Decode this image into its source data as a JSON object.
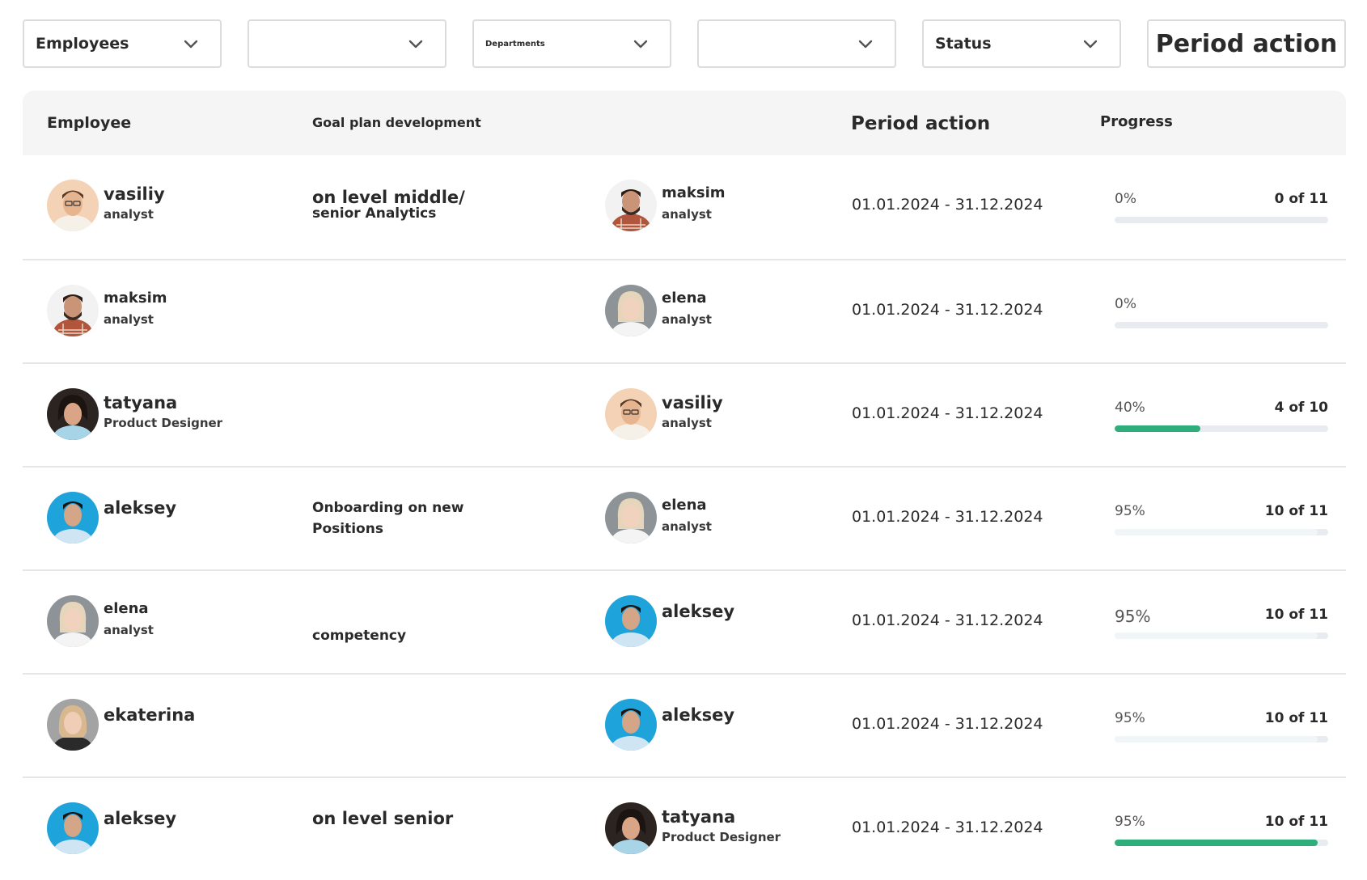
{
  "filters": {
    "employees": "Employees",
    "filter2": "",
    "departments": "Departments",
    "filter4": "",
    "status": "Status",
    "period_action": "Period action"
  },
  "header": {
    "employee": "Employee",
    "goal": "Goal plan development",
    "period": "Period action",
    "progress": "Progress"
  },
  "colors": {
    "accent": "#2dae7a",
    "track": "#e8ecf1",
    "header_bg": "#f5f5f5"
  },
  "rows": [
    {
      "employee": {
        "name": "vasiliy",
        "role": "analyst",
        "avatar": "avatar-vasiliy"
      },
      "goal_line1": "on level middle/",
      "goal_line2": "senior Analytics",
      "mentor": {
        "name": "maksim",
        "role": "analyst",
        "avatar": "avatar-maksim"
      },
      "period": "01.01.2024 - 31.12.2024",
      "progress_label": "0%",
      "count": "0 of 11",
      "progress": 0
    },
    {
      "employee": {
        "name": "maksim",
        "role": "analyst",
        "avatar": "avatar-maksim"
      },
      "goal_line1": "",
      "goal_line2": "",
      "mentor": {
        "name": "elena",
        "role": "analyst",
        "avatar": "avatar-elena"
      },
      "period": "01.01.2024 - 31.12.2024",
      "progress_label": "0%",
      "count": "",
      "progress": 0
    },
    {
      "employee": {
        "name": "tatyana",
        "role": "Product Designer",
        "avatar": "avatar-tatyana"
      },
      "goal_line1": "",
      "goal_line2": "",
      "mentor": {
        "name": "vasiliy",
        "role": "analyst",
        "avatar": "avatar-vasiliy"
      },
      "period": "01.01.2024 - 31.12.2024",
      "progress_label": "40%",
      "count": "4 of 10",
      "progress": 40
    },
    {
      "employee": {
        "name": "aleksey",
        "role": "",
        "avatar": "avatar-aleksey"
      },
      "goal_line1": "Onboarding on new",
      "goal_line2": "Positions",
      "mentor": {
        "name": "elena",
        "role": "analyst",
        "avatar": "avatar-elena"
      },
      "period": "01.01.2024 - 31.12.2024",
      "progress_label": "95%",
      "count": "10 of 11",
      "progress": 95
    },
    {
      "employee": {
        "name": "elena",
        "role": "analyst",
        "avatar": "avatar-elena"
      },
      "goal_line1": "",
      "goal_line2": "competency",
      "mentor": {
        "name": "aleksey",
        "role": "",
        "avatar": "avatar-aleksey"
      },
      "period": "01.01.2024 - 31.12.2024",
      "progress_label": "95%",
      "count": "10 of 11",
      "progress": 95
    },
    {
      "employee": {
        "name": "ekaterina",
        "role": "",
        "avatar": "avatar-ekaterina"
      },
      "goal_line1": "",
      "goal_line2": "",
      "mentor": {
        "name": "aleksey",
        "role": "",
        "avatar": "avatar-aleksey"
      },
      "period": "01.01.2024 - 31.12.2024",
      "progress_label": "95%",
      "count": "10 of 11",
      "progress": 95
    },
    {
      "employee": {
        "name": "aleksey",
        "role": "",
        "avatar": "avatar-aleksey"
      },
      "goal_line1": "on level senior",
      "goal_line2": "",
      "mentor": {
        "name": "tatyana",
        "role": "Product Designer",
        "avatar": "avatar-tatyana"
      },
      "period": "01.01.2024 - 31.12.2024",
      "progress_label": "95%",
      "count": "10 of 11",
      "progress": 95
    }
  ]
}
